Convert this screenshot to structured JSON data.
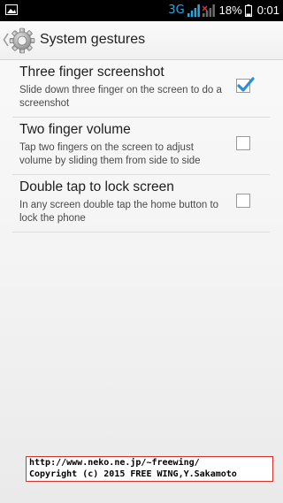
{
  "status_bar": {
    "network_type": "3G",
    "battery_percent": "18%",
    "time": "0:01",
    "icons": [
      "notification-image-icon",
      "signal-strength-icon",
      "signal-strength-secondary-icon",
      "battery-icon"
    ],
    "network_color": "#29a8e0"
  },
  "action_bar": {
    "title": "System gestures",
    "icon": "settings-gear-icon",
    "back_icon": "back-chevron-icon"
  },
  "preferences": [
    {
      "title": "Three finger screenshot",
      "summary": "Slide down three finger on the screen to do a screenshot",
      "checked": true
    },
    {
      "title": "Two finger volume",
      "summary": "Tap two fingers on the screen to adjust volume by sliding them from side to side",
      "checked": false
    },
    {
      "title": "Double tap to lock screen",
      "summary": "In any screen double tap the home button to lock the phone",
      "checked": false
    }
  ],
  "watermark": {
    "line1": "http://www.neko.ne.jp/~freewing/",
    "line2": "Copyright (c) 2015 FREE WING,Y.Sakamoto"
  },
  "colors": {
    "accent": "#2a8fd6",
    "status_bar_bg": "#000000",
    "watermark_border": "#d43030"
  }
}
